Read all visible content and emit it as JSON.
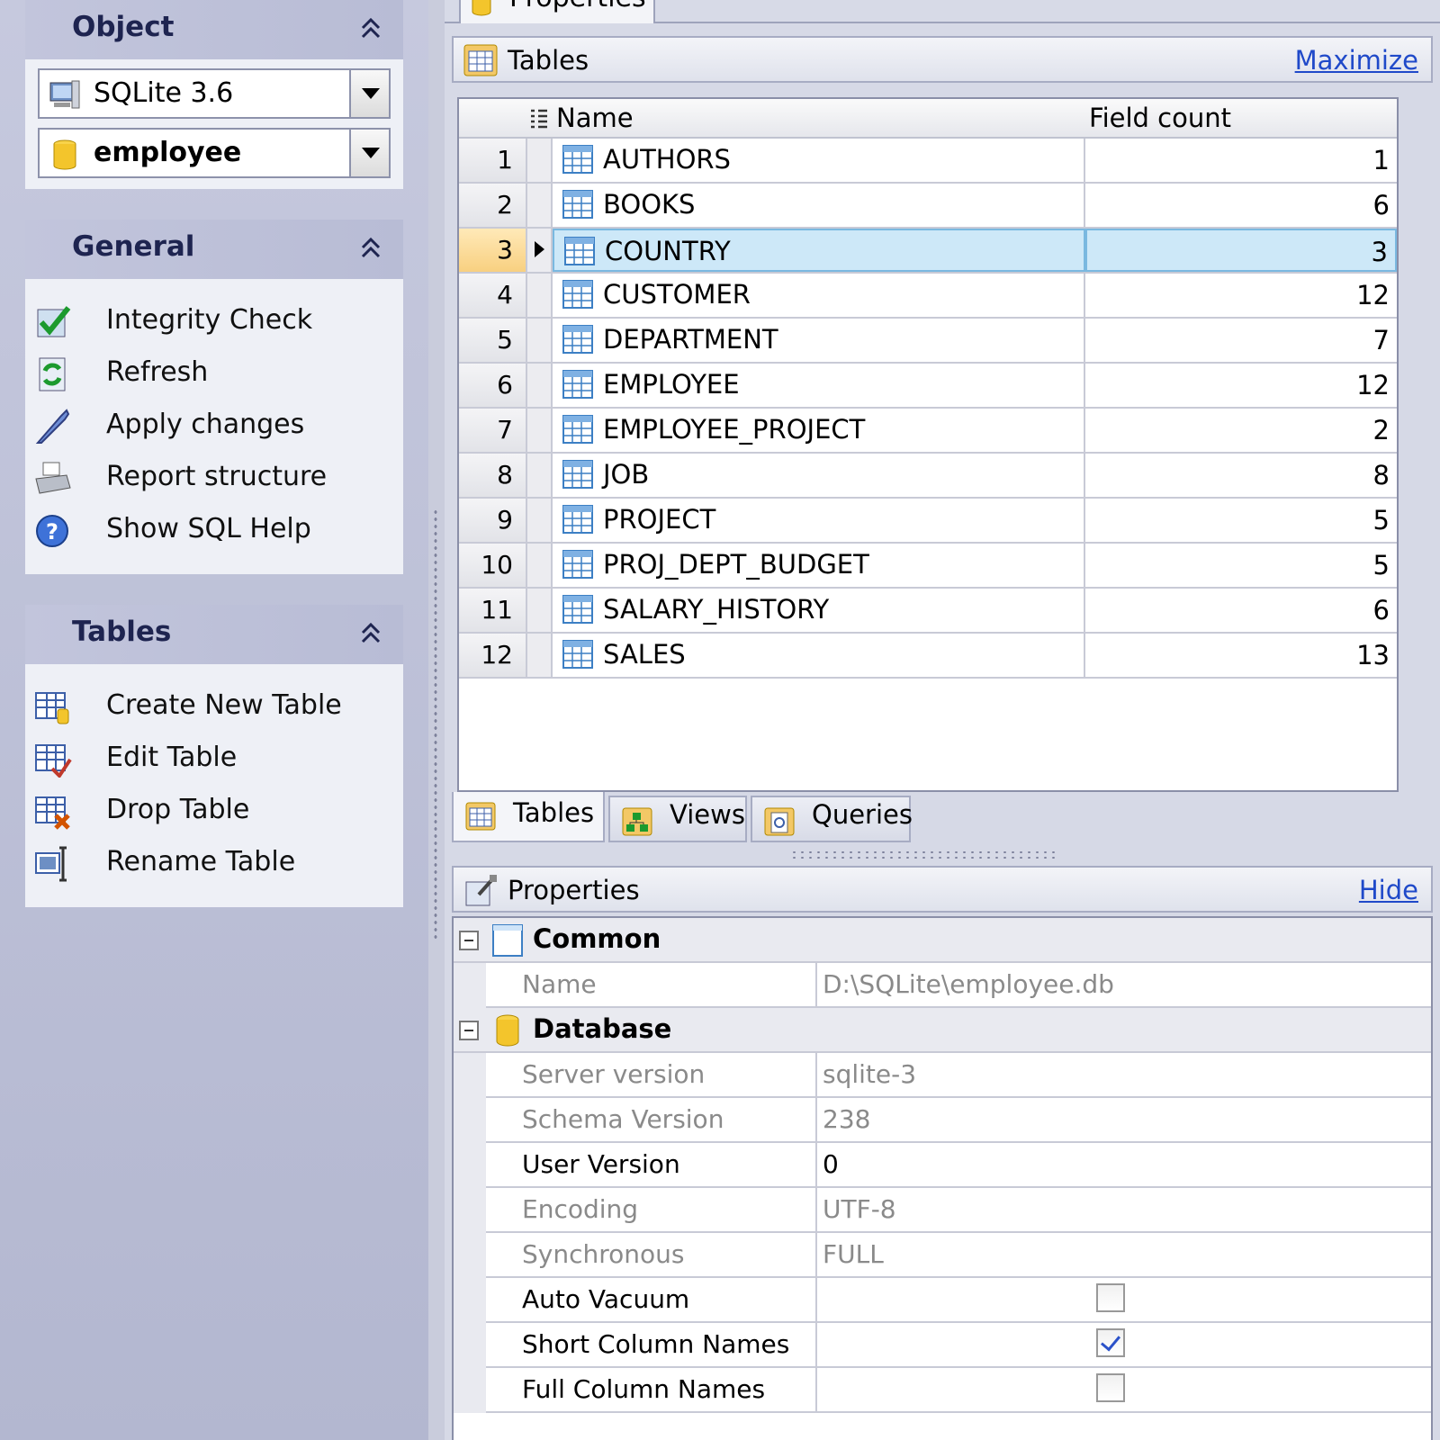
{
  "nav": {
    "object": {
      "title": "Object",
      "server": "SQLite 3.6",
      "database": "employee"
    },
    "general": {
      "title": "General",
      "items": [
        {
          "label": "Integrity Check",
          "icon": "integrity-check-icon"
        },
        {
          "label": "Refresh",
          "icon": "refresh-icon"
        },
        {
          "label": "Apply changes",
          "icon": "apply-changes-icon"
        },
        {
          "label": "Report structure",
          "icon": "printer-icon"
        },
        {
          "label": "Show SQL Help",
          "icon": "help-icon"
        }
      ]
    },
    "tables": {
      "title": "Tables",
      "items": [
        {
          "label": "Create New Table",
          "icon": "create-table-icon"
        },
        {
          "label": "Edit Table",
          "icon": "edit-table-icon"
        },
        {
          "label": "Drop Table",
          "icon": "drop-table-icon"
        },
        {
          "label": "Rename Table",
          "icon": "rename-table-icon"
        }
      ]
    }
  },
  "top_tab": {
    "label": "Properties"
  },
  "tables_section": {
    "title": "Tables",
    "link": "Maximize",
    "columns": {
      "name": "Name",
      "field_count": "Field count"
    },
    "selected_row": 3,
    "rows": [
      {
        "n": "1",
        "name": "AUTHORS",
        "count": "1"
      },
      {
        "n": "2",
        "name": "BOOKS",
        "count": "6"
      },
      {
        "n": "3",
        "name": "COUNTRY",
        "count": "3"
      },
      {
        "n": "4",
        "name": "CUSTOMER",
        "count": "12"
      },
      {
        "n": "5",
        "name": "DEPARTMENT",
        "count": "7"
      },
      {
        "n": "6",
        "name": "EMPLOYEE",
        "count": "12"
      },
      {
        "n": "7",
        "name": "EMPLOYEE_PROJECT",
        "count": "2"
      },
      {
        "n": "8",
        "name": "JOB",
        "count": "8"
      },
      {
        "n": "9",
        "name": "PROJECT",
        "count": "5"
      },
      {
        "n": "10",
        "name": "PROJ_DEPT_BUDGET",
        "count": "5"
      },
      {
        "n": "11",
        "name": "SALARY_HISTORY",
        "count": "6"
      },
      {
        "n": "12",
        "name": "SALES",
        "count": "13"
      }
    ]
  },
  "bottom_tabs": [
    {
      "label": "Tables",
      "icon": "table-icon",
      "active": true
    },
    {
      "label": "Views",
      "icon": "views-icon",
      "active": false
    },
    {
      "label": "Queries",
      "icon": "queries-icon",
      "active": false
    }
  ],
  "properties": {
    "title": "Properties",
    "link": "Hide",
    "common": {
      "title": "Common",
      "name_label": "Name",
      "name_value": "D:\\SQLite\\employee.db"
    },
    "database": {
      "title": "Database",
      "rows": [
        {
          "label": "Server version",
          "value": "sqlite-3",
          "editable": false
        },
        {
          "label": "Schema Version",
          "value": "238",
          "editable": false
        },
        {
          "label": "User Version",
          "value": "0",
          "editable": true
        },
        {
          "label": "Encoding",
          "value": "UTF-8",
          "editable": false
        },
        {
          "label": "Synchronous",
          "value": "FULL",
          "editable": false
        }
      ],
      "checks": [
        {
          "label": "Auto Vacuum",
          "checked": false
        },
        {
          "label": "Short Column Names",
          "checked": true
        },
        {
          "label": "Full Column Names",
          "checked": false
        }
      ]
    }
  },
  "colors": {
    "nav_bg": "#c3c7db",
    "link": "#1f49c9",
    "selected_row": "#cde8f8"
  }
}
